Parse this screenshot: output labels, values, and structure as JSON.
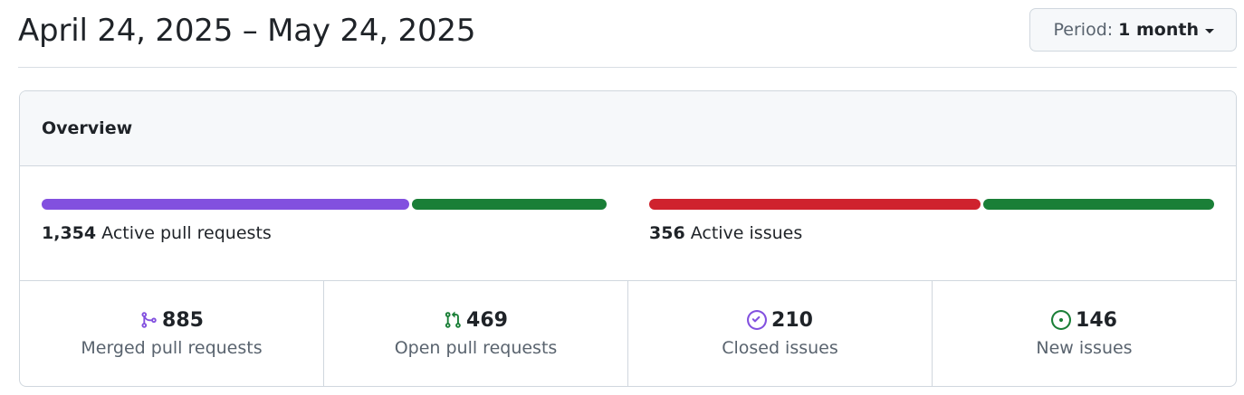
{
  "header": {
    "date_range": "April 24, 2025 – May 24, 2025",
    "period_label": "Period:",
    "period_value": "1 month"
  },
  "overview": {
    "title": "Overview",
    "pull_requests": {
      "count": "1,354",
      "label": "Active pull requests",
      "segments": [
        {
          "name": "Merged",
          "value": 885,
          "color": "#8250df"
        },
        {
          "name": "Open",
          "value": 469,
          "color": "#1a7f37"
        }
      ]
    },
    "issues": {
      "count": "356",
      "label": "Active issues",
      "segments": [
        {
          "name": "Closed",
          "value": 210,
          "color": "#cf222e"
        },
        {
          "name": "New",
          "value": 146,
          "color": "#1a7f37"
        }
      ]
    },
    "stats": [
      {
        "icon": "git-merge-icon",
        "value": "885",
        "label": "Merged pull requests",
        "color": "#8250df"
      },
      {
        "icon": "git-pull-request-icon",
        "value": "469",
        "label": "Open pull requests",
        "color": "#1a7f37"
      },
      {
        "icon": "issue-closed-icon",
        "value": "210",
        "label": "Closed issues",
        "color": "#8250df"
      },
      {
        "icon": "issue-opened-icon",
        "value": "146",
        "label": "New issues",
        "color": "#1a7f37"
      }
    ]
  }
}
